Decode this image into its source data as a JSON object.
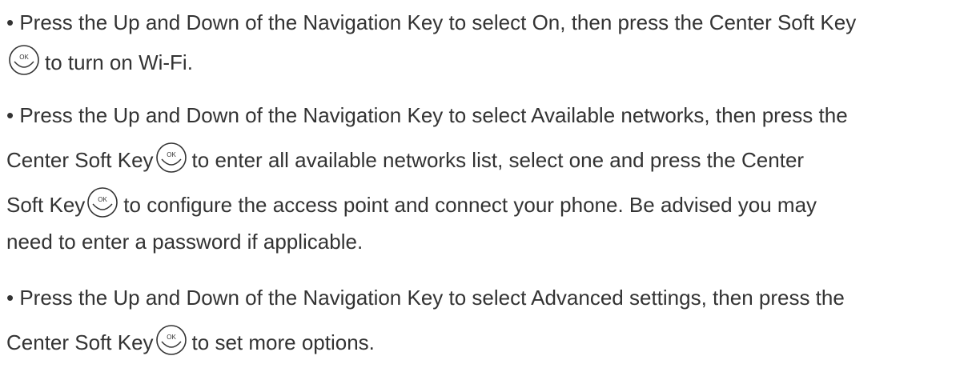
{
  "bullet1": {
    "line1": "• Press the Up and Down of the Navigation Key to select On, then press the Center Soft Key",
    "line2": "to turn on Wi-Fi."
  },
  "bullet2": {
    "line1": "• Press the Up and Down of the Navigation Key to select Available networks, then press the",
    "line2a": "Center Soft Key",
    "line2b": "to enter all available networks list, select one and press the Center",
    "line3a": "Soft Key",
    "line3b": "to configure the access point and connect your phone. Be advised you may",
    "line4": "need to enter a password if applicable."
  },
  "bullet3": {
    "line1": "• Press the Up and Down of the Navigation Key to select Advanced settings, then press the",
    "line2a": "Center Soft Key",
    "line2b": "to set more options."
  },
  "icons": {
    "center_soft_key_label": "OK",
    "center_soft_key_icon": "center-soft-key-icon"
  }
}
